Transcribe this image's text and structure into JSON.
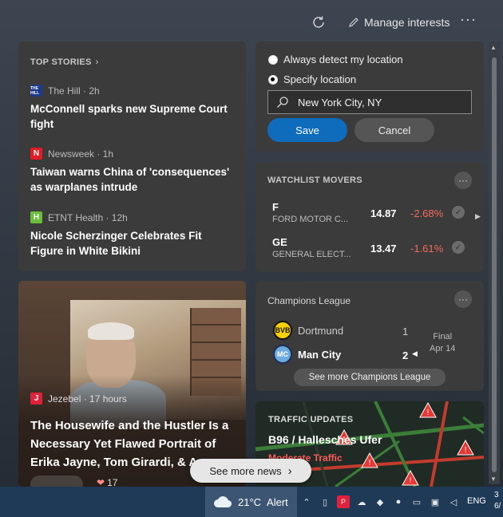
{
  "toolbar": {
    "manage_label": "Manage interests",
    "more_label": "···"
  },
  "top_stories": {
    "title": "TOP STORIES",
    "items": [
      {
        "source": "The Hill · 2h",
        "logo_text": "THE HILL",
        "logo_color": "#1e3a8a",
        "headline": "McConnell sparks new Supreme Court fight"
      },
      {
        "source": "Newsweek · 1h",
        "logo_text": "N",
        "logo_color": "#e31b23",
        "headline": "Taiwan warns China of 'consequences' as warplanes intrude"
      },
      {
        "source": "ETNT Health · 12h",
        "logo_text": "H",
        "logo_color": "#6bbf3a",
        "headline": "Nicole Scherzinger Celebrates Fit Figure in White Bikini"
      }
    ]
  },
  "big_story": {
    "source": "Jezebel · 17 hours",
    "logo_text": "J",
    "logo_color": "#e0213c",
    "headline": "The Housewife and the Hustler Is a Necessary Yet Flawed Portrait of Erika Jayne, Tom Girardi, & An",
    "like_count": "17"
  },
  "location": {
    "option_always": "Always detect my location",
    "option_specify": "Specify location",
    "selected": "specify",
    "input_value": "New York City, NY",
    "save_label": "Save",
    "cancel_label": "Cancel"
  },
  "watchlist": {
    "title": "WATCHLIST MOVERS",
    "stocks": [
      {
        "symbol": "F",
        "name": "FORD MOTOR C...",
        "price": "14.87",
        "change": "-2.68%"
      },
      {
        "symbol": "GE",
        "name": "GENERAL ELECT...",
        "price": "13.47",
        "change": "-1.61%"
      }
    ]
  },
  "champions": {
    "title": "Champions League",
    "team1": {
      "name": "Dortmund",
      "score": "1"
    },
    "team2": {
      "name": "Man City",
      "score": "2"
    },
    "status": "Final",
    "date": "Apr 14",
    "see_more": "See more Champions League"
  },
  "traffic": {
    "title": "TRAFFIC UPDATES",
    "road": "B96 / Hallesches Ufer",
    "status": "Moderate Traffic"
  },
  "see_more_news": "See more news",
  "taskbar": {
    "weather": "21°C",
    "alert": "Alert",
    "language": "ENG",
    "clock_line1": "3",
    "clock_line2": "6/"
  },
  "colors": {
    "accent": "#0f6cbd",
    "negative": "#f46a5a",
    "taskbar": "#1e3a57"
  }
}
